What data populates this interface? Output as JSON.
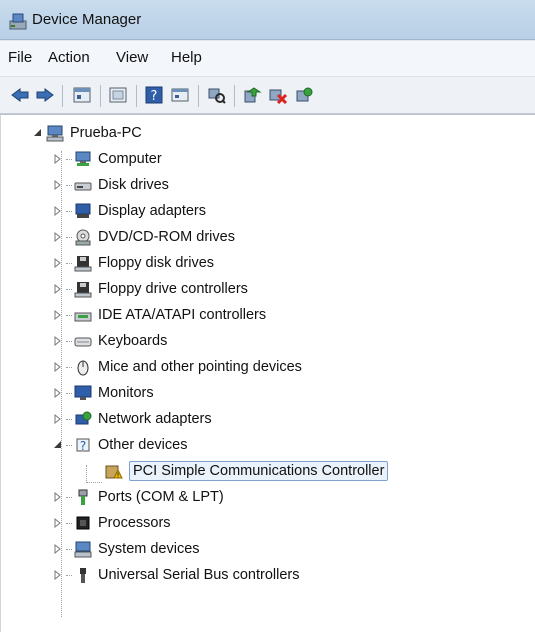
{
  "window": {
    "title": "Device Manager"
  },
  "menu": {
    "file": "File",
    "action": "Action",
    "view": "View",
    "help": "Help"
  },
  "toolbar": {
    "icons": [
      "back-arrow-icon",
      "forward-arrow-icon",
      "properties-icon",
      "show-hide-icon",
      "help-icon",
      "console-icon",
      "scan-hardware-icon",
      "update-driver-icon",
      "disable-device-icon",
      "uninstall-icon"
    ]
  },
  "tree": {
    "root": {
      "label": "Prueba-PC"
    },
    "categories": [
      {
        "label": "Computer"
      },
      {
        "label": "Disk drives"
      },
      {
        "label": "Display adapters"
      },
      {
        "label": "DVD/CD-ROM drives"
      },
      {
        "label": "Floppy disk drives"
      },
      {
        "label": "Floppy drive controllers"
      },
      {
        "label": "IDE ATA/ATAPI controllers"
      },
      {
        "label": "Keyboards"
      },
      {
        "label": "Mice and other pointing devices"
      },
      {
        "label": "Monitors"
      },
      {
        "label": "Network adapters"
      },
      {
        "label": "Other devices"
      },
      {
        "label": "PCI Simple Communications Controller"
      },
      {
        "label": "Ports (COM & LPT)"
      },
      {
        "label": "Processors"
      },
      {
        "label": "System devices"
      },
      {
        "label": "Universal Serial Bus controllers"
      }
    ]
  },
  "colors": {
    "selection_border": "#7da2ce",
    "warning": "#f2b600"
  }
}
